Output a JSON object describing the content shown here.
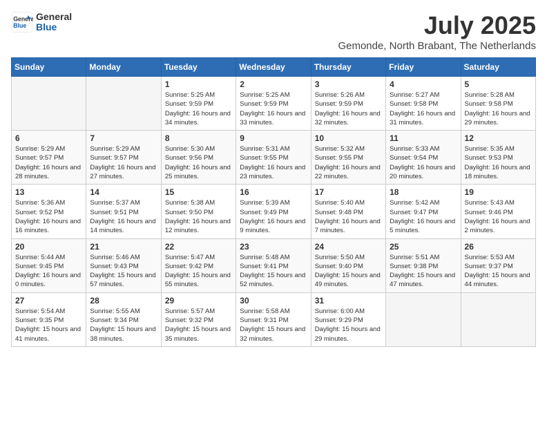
{
  "header": {
    "logo": {
      "general": "General",
      "blue": "Blue"
    },
    "month_year": "July 2025",
    "location": "Gemonde, North Brabant, The Netherlands"
  },
  "days_of_week": [
    "Sunday",
    "Monday",
    "Tuesday",
    "Wednesday",
    "Thursday",
    "Friday",
    "Saturday"
  ],
  "weeks": [
    [
      {
        "day": "",
        "info": ""
      },
      {
        "day": "",
        "info": ""
      },
      {
        "day": "1",
        "info": "Sunrise: 5:25 AM\nSunset: 9:59 PM\nDaylight: 16 hours and 34 minutes."
      },
      {
        "day": "2",
        "info": "Sunrise: 5:25 AM\nSunset: 9:59 PM\nDaylight: 16 hours and 33 minutes."
      },
      {
        "day": "3",
        "info": "Sunrise: 5:26 AM\nSunset: 9:59 PM\nDaylight: 16 hours and 32 minutes."
      },
      {
        "day": "4",
        "info": "Sunrise: 5:27 AM\nSunset: 9:58 PM\nDaylight: 16 hours and 31 minutes."
      },
      {
        "day": "5",
        "info": "Sunrise: 5:28 AM\nSunset: 9:58 PM\nDaylight: 16 hours and 29 minutes."
      }
    ],
    [
      {
        "day": "6",
        "info": "Sunrise: 5:29 AM\nSunset: 9:57 PM\nDaylight: 16 hours and 28 minutes."
      },
      {
        "day": "7",
        "info": "Sunrise: 5:29 AM\nSunset: 9:57 PM\nDaylight: 16 hours and 27 minutes."
      },
      {
        "day": "8",
        "info": "Sunrise: 5:30 AM\nSunset: 9:56 PM\nDaylight: 16 hours and 25 minutes."
      },
      {
        "day": "9",
        "info": "Sunrise: 5:31 AM\nSunset: 9:55 PM\nDaylight: 16 hours and 23 minutes."
      },
      {
        "day": "10",
        "info": "Sunrise: 5:32 AM\nSunset: 9:55 PM\nDaylight: 16 hours and 22 minutes."
      },
      {
        "day": "11",
        "info": "Sunrise: 5:33 AM\nSunset: 9:54 PM\nDaylight: 16 hours and 20 minutes."
      },
      {
        "day": "12",
        "info": "Sunrise: 5:35 AM\nSunset: 9:53 PM\nDaylight: 16 hours and 18 minutes."
      }
    ],
    [
      {
        "day": "13",
        "info": "Sunrise: 5:36 AM\nSunset: 9:52 PM\nDaylight: 16 hours and 16 minutes."
      },
      {
        "day": "14",
        "info": "Sunrise: 5:37 AM\nSunset: 9:51 PM\nDaylight: 16 hours and 14 minutes."
      },
      {
        "day": "15",
        "info": "Sunrise: 5:38 AM\nSunset: 9:50 PM\nDaylight: 16 hours and 12 minutes."
      },
      {
        "day": "16",
        "info": "Sunrise: 5:39 AM\nSunset: 9:49 PM\nDaylight: 16 hours and 9 minutes."
      },
      {
        "day": "17",
        "info": "Sunrise: 5:40 AM\nSunset: 9:48 PM\nDaylight: 16 hours and 7 minutes."
      },
      {
        "day": "18",
        "info": "Sunrise: 5:42 AM\nSunset: 9:47 PM\nDaylight: 16 hours and 5 minutes."
      },
      {
        "day": "19",
        "info": "Sunrise: 5:43 AM\nSunset: 9:46 PM\nDaylight: 16 hours and 2 minutes."
      }
    ],
    [
      {
        "day": "20",
        "info": "Sunrise: 5:44 AM\nSunset: 9:45 PM\nDaylight: 16 hours and 0 minutes."
      },
      {
        "day": "21",
        "info": "Sunrise: 5:46 AM\nSunset: 9:43 PM\nDaylight: 15 hours and 57 minutes."
      },
      {
        "day": "22",
        "info": "Sunrise: 5:47 AM\nSunset: 9:42 PM\nDaylight: 15 hours and 55 minutes."
      },
      {
        "day": "23",
        "info": "Sunrise: 5:48 AM\nSunset: 9:41 PM\nDaylight: 15 hours and 52 minutes."
      },
      {
        "day": "24",
        "info": "Sunrise: 5:50 AM\nSunset: 9:40 PM\nDaylight: 15 hours and 49 minutes."
      },
      {
        "day": "25",
        "info": "Sunrise: 5:51 AM\nSunset: 9:38 PM\nDaylight: 15 hours and 47 minutes."
      },
      {
        "day": "26",
        "info": "Sunrise: 5:53 AM\nSunset: 9:37 PM\nDaylight: 15 hours and 44 minutes."
      }
    ],
    [
      {
        "day": "27",
        "info": "Sunrise: 5:54 AM\nSunset: 9:35 PM\nDaylight: 15 hours and 41 minutes."
      },
      {
        "day": "28",
        "info": "Sunrise: 5:55 AM\nSunset: 9:34 PM\nDaylight: 15 hours and 38 minutes."
      },
      {
        "day": "29",
        "info": "Sunrise: 5:57 AM\nSunset: 9:32 PM\nDaylight: 15 hours and 35 minutes."
      },
      {
        "day": "30",
        "info": "Sunrise: 5:58 AM\nSunset: 9:31 PM\nDaylight: 15 hours and 32 minutes."
      },
      {
        "day": "31",
        "info": "Sunrise: 6:00 AM\nSunset: 9:29 PM\nDaylight: 15 hours and 29 minutes."
      },
      {
        "day": "",
        "info": ""
      },
      {
        "day": "",
        "info": ""
      }
    ]
  ]
}
